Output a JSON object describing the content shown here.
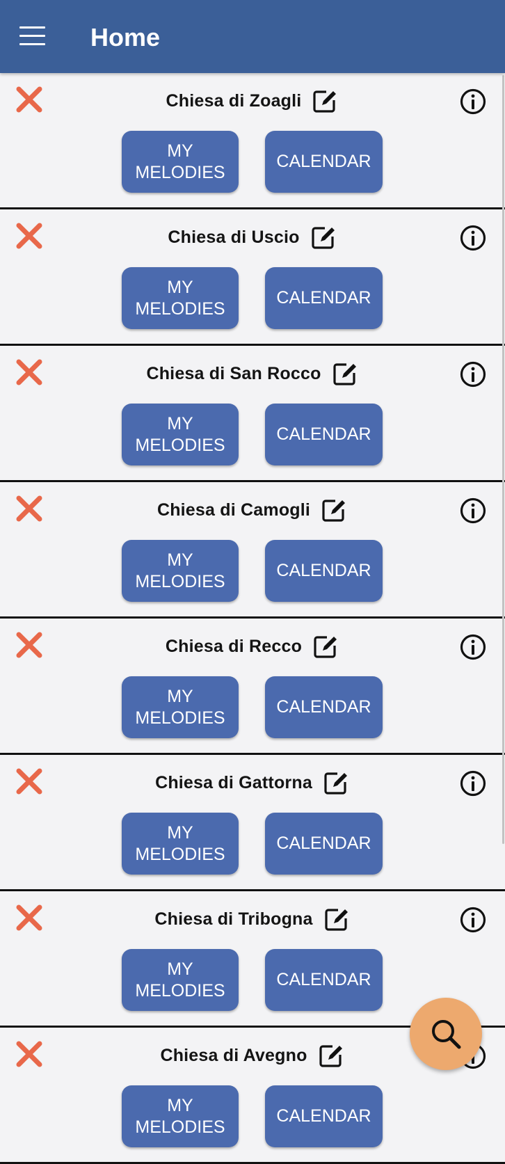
{
  "header": {
    "title": "Home",
    "menu_icon": "hamburger-menu-icon",
    "background": "#3b5f98"
  },
  "churches": [
    {
      "name": "Chiesa di Zoagli"
    },
    {
      "name": "Chiesa di Uscio"
    },
    {
      "name": "Chiesa di San Rocco"
    },
    {
      "name": "Chiesa di Camogli"
    },
    {
      "name": "Chiesa di Recco"
    },
    {
      "name": "Chiesa di Gattorna"
    },
    {
      "name": "Chiesa di Tribogna"
    },
    {
      "name": "Chiesa di Avegno"
    }
  ],
  "card": {
    "melodies_line1": "MY",
    "melodies_line2": "MELODIES",
    "calendar_label": "CALENDAR",
    "delete_icon": "delete-x-icon",
    "edit_icon": "edit-icon",
    "info_icon": "info-icon"
  },
  "fab": {
    "icon": "search-icon"
  },
  "colors": {
    "accent_button": "#4b6aae",
    "delete": "#e8684a",
    "fab": "#eda96e",
    "background": "#f3f3f5"
  }
}
